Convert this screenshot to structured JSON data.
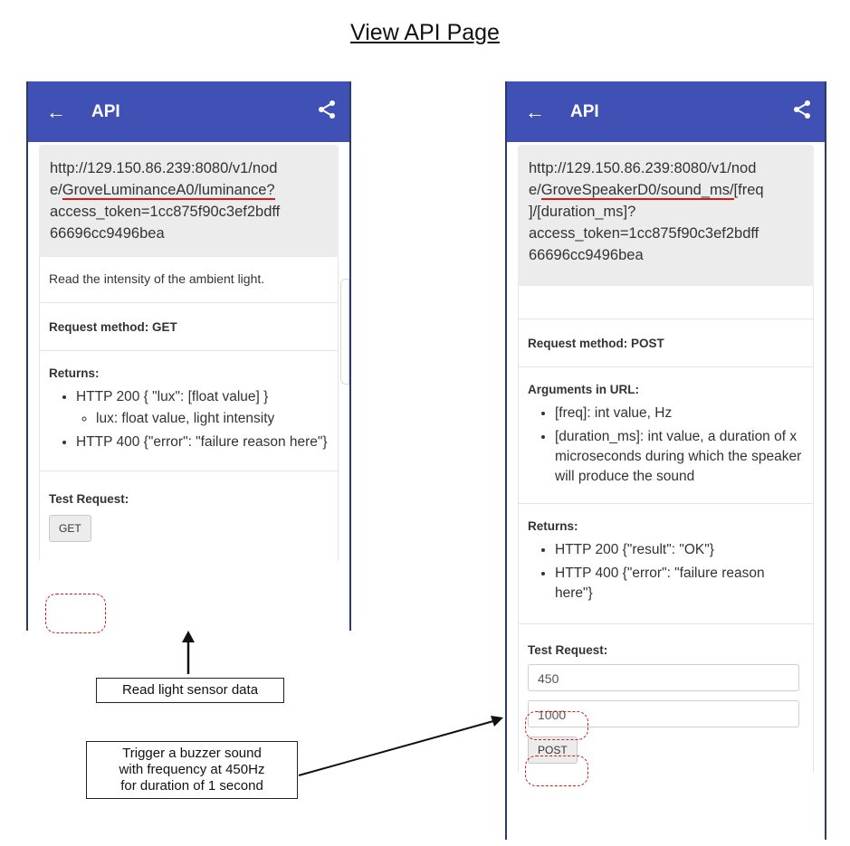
{
  "page_title": "View API Page",
  "left_screen": {
    "appbar": {
      "back_icon": "arrow-left-icon",
      "title": "API",
      "share_icon": "share-icon"
    },
    "url_part1": "http://129.150.86.239:8080/v1/nod",
    "url_part2_prefix": "e/",
    "url_part2_underlined": "GroveLuminanceA0/luminance?",
    "url_part3": "access_token=1cc875f90c3ef2bdff",
    "url_part4": "66696cc9496bea",
    "description": "Read the intensity of the ambient light.",
    "request_method": "Request method: GET",
    "returns_label": "Returns:",
    "returns_item1": "HTTP 200 { \"lux\": [float value] }",
    "returns_subitem1": "lux: float value, light intensity",
    "returns_item2": "HTTP 400 {\"error\": \"failure reason here\"}",
    "test_label": "Test Request:",
    "get_button": "GET"
  },
  "right_screen": {
    "appbar": {
      "back_icon": "arrow-left-icon",
      "title": "API",
      "share_icon": "share-icon"
    },
    "url_part1": "http://129.150.86.239:8080/v1/nod",
    "url_part2_prefix": "e/",
    "url_part2_underlined": "GroveSpeakerD0/sound_ms/",
    "url_part2_suffix": "[freq",
    "url_part3": "]/[duration_ms]?",
    "url_part4": "access_token=1cc875f90c3ef2bdff",
    "url_part5": "66696cc9496bea",
    "request_method": "Request method: POST",
    "args_label": "Arguments in URL:",
    "arg1": "[freq]: int value, Hz",
    "arg2": "[duration_ms]: int value, a duration of x microseconds during which the speaker will produce the sound",
    "returns_label": "Returns:",
    "returns_item1": "HTTP 200 {\"result\": \"OK\"}",
    "returns_item2": "HTTP 400 {\"error\": \"failure reason here\"}",
    "test_label": "Test Request:",
    "freq_value": "450",
    "duration_value": "1000",
    "post_button": "POST"
  },
  "annotations": {
    "left_caption": "Read light sensor data",
    "right_caption_line1": "Trigger a buzzer sound",
    "right_caption_line2": "with frequency at 450Hz",
    "right_caption_line3": "for  duration of 1 second"
  },
  "colors": {
    "appbar": "#3f51b5",
    "highlight": "#d01c1c",
    "card": "#ececec"
  }
}
